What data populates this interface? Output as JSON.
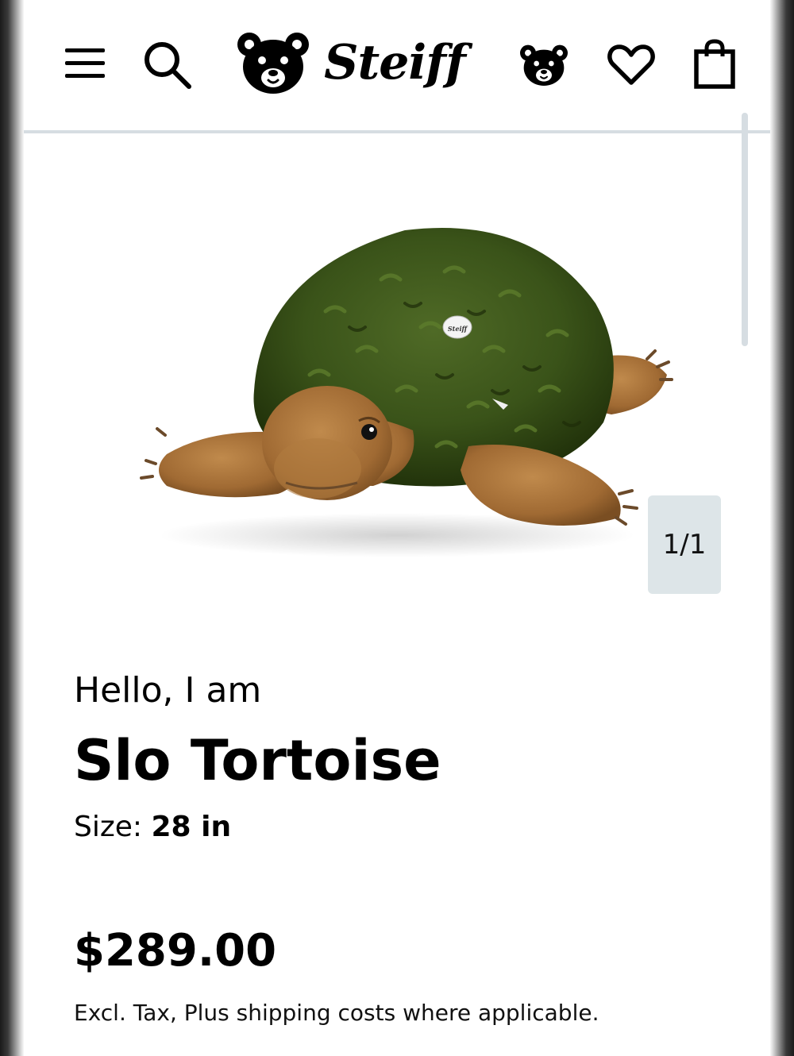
{
  "header": {
    "logo_text": "Steiff",
    "icons": {
      "menu": "hamburger-menu-icon",
      "search": "search-icon",
      "logo_bear": "bear-head-logo-icon",
      "account": "bear-head-account-icon",
      "wishlist": "heart-icon",
      "cart": "shopping-bag-icon"
    }
  },
  "gallery": {
    "image_counter": "1/1",
    "image_badge_text": "Steiff"
  },
  "product": {
    "greeting": "Hello, I am",
    "name": "Slo Tortoise",
    "size_label": "Size:",
    "size_value": "28 in",
    "price": "$289.00",
    "price_note": "Excl. Tax, Plus shipping costs where applicable."
  },
  "colors": {
    "divider": "#d6dde2",
    "counter_bg": "#dde5e8",
    "shell": "#3f5a1c",
    "skin": "#a8733a"
  }
}
